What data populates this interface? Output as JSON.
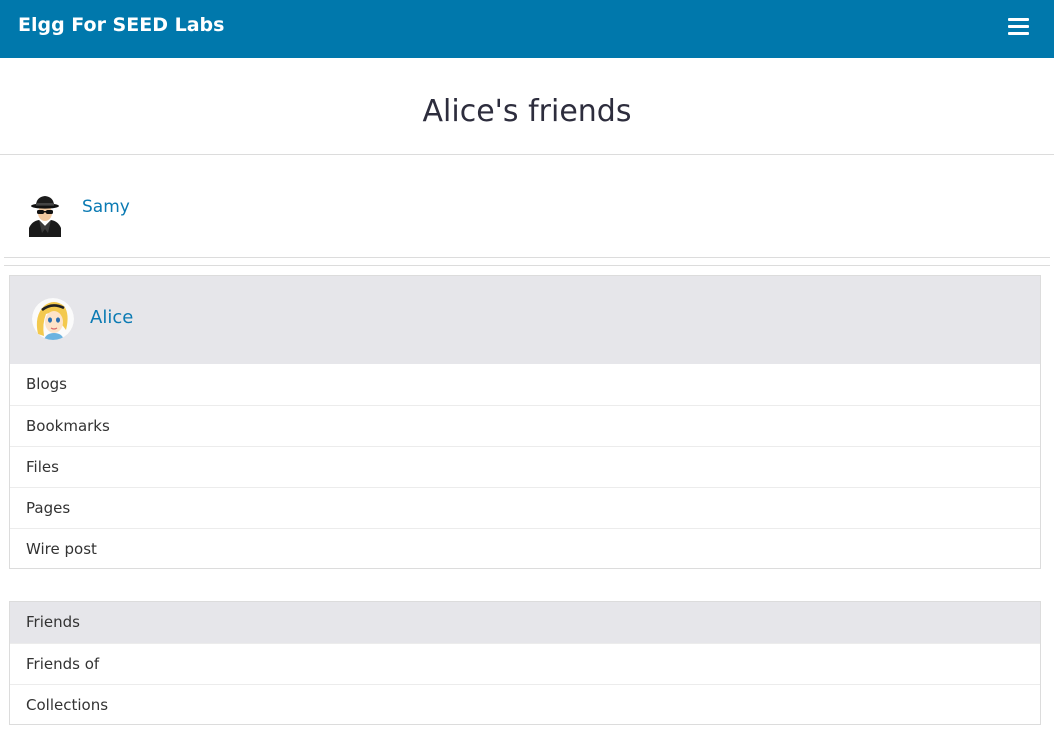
{
  "header": {
    "site_title": "Elgg For SEED Labs",
    "menu_icon": "hamburger-menu-icon",
    "background_color": "#0078ac"
  },
  "page": {
    "title": "Alice's friends"
  },
  "friends": [
    {
      "name": "Samy",
      "avatar": "spy-avatar"
    }
  ],
  "owner": {
    "name": "Alice",
    "avatar": "alice-avatar",
    "menu": [
      "Blogs",
      "Bookmarks",
      "Files",
      "Pages",
      "Wire post"
    ]
  },
  "nav": {
    "items": [
      "Friends",
      "Friends of",
      "Collections"
    ],
    "selected": "Friends"
  },
  "colors": {
    "link": "#0a7ab3",
    "panel_highlight": "#e6e6ea"
  }
}
